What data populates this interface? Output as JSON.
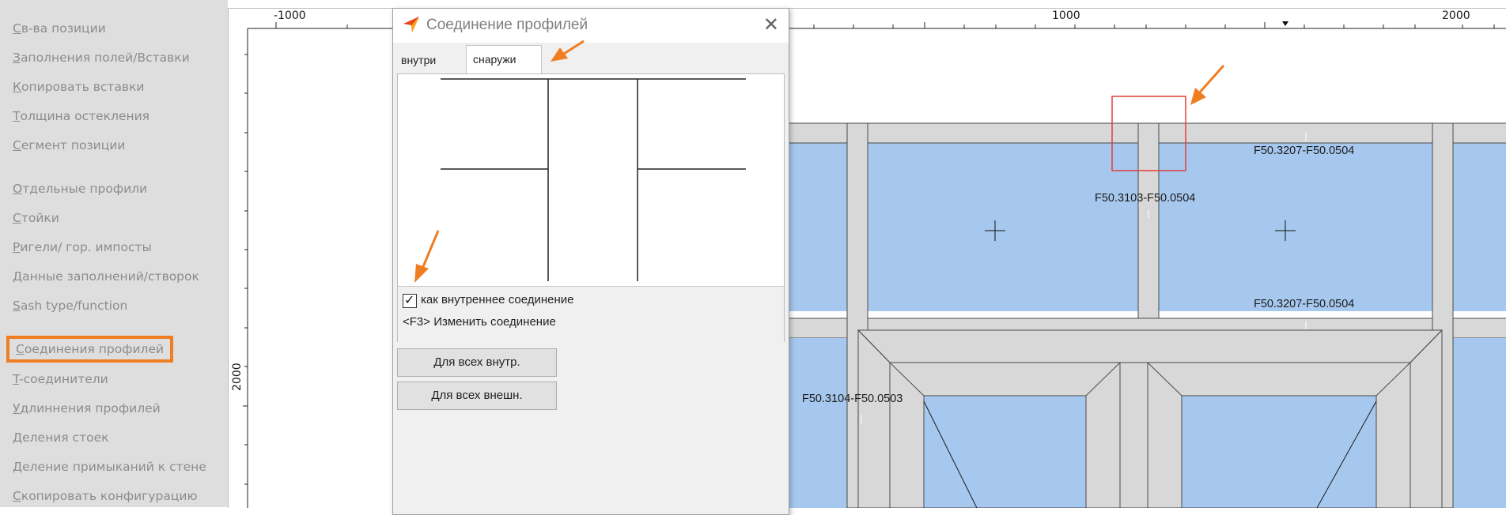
{
  "sidebar": {
    "items": [
      {
        "label": "Св-ва позиции"
      },
      {
        "label": "Заполнения полей/Вставки"
      },
      {
        "label": "Копировать вставки"
      },
      {
        "label": "Толщина остекления"
      },
      {
        "label": "Сегмент позиции"
      },
      {
        "label": "Отдельные профили"
      },
      {
        "label": "Стойки"
      },
      {
        "label": "Ригели/ гор. импосты"
      },
      {
        "label": "Данные заполнений/створок"
      },
      {
        "label": "Sash type/function"
      },
      {
        "label": "Соединения профилей",
        "active": true
      },
      {
        "label": "T-соединители"
      },
      {
        "label": "Удлиннения профилей"
      },
      {
        "label": "Деления стоек"
      },
      {
        "label": "Деление примыканий к стене"
      },
      {
        "label": "Скопировать конфигурацию"
      }
    ]
  },
  "ruler": {
    "top_labels": [
      "-1000",
      "1000",
      "2000"
    ],
    "left_label": "2000"
  },
  "drawing": {
    "profile_labels": [
      "F50.3207-F50.0504",
      "F50.3103-F50.0504",
      "F50.3207-F50.0504",
      "F50.3104-F50.0503"
    ],
    "glass_color": "#a7c8ee",
    "frame_color": "#d8d8d8",
    "highlight_color": "#e0403a"
  },
  "dialog": {
    "title": "Соединение профилей",
    "close_glyph": "✕",
    "tabs": [
      "внутри",
      "снаружи"
    ],
    "active_tab": "снаружи",
    "checkbox": {
      "label": "как внутреннее соединение",
      "checked": true,
      "glyph": "✓"
    },
    "hint": "<F3> Изменить соединение",
    "buttons": {
      "all_inside": "Для всех внутр.",
      "all_outside": "Для всех внешн."
    }
  },
  "accent_color": "#ef7d22"
}
